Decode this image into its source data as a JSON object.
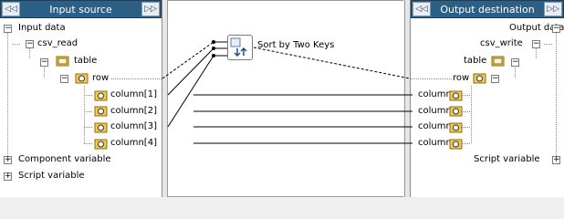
{
  "left_panel": {
    "title": "Input source",
    "prev_label": "◁◁",
    "next_label": "▷▷",
    "tree": {
      "root": "Input data",
      "csv": "csv_read",
      "table": "table",
      "row": "row",
      "columns": [
        "column[1]",
        "column[2]",
        "column[3]",
        "column[4]"
      ],
      "component_var": "Component variable",
      "script_var": "Script variable"
    }
  },
  "right_panel": {
    "title": "Output destination",
    "prev_label": "◁◁",
    "next_label": "▷▷",
    "tree": {
      "root": "Output data",
      "csv": "csv_write",
      "table": "table",
      "row": "row",
      "columns": [
        "column",
        "column",
        "column",
        "column"
      ],
      "script_var": "Script variable"
    }
  },
  "canvas": {
    "sort_node_label": "Sort by Two Keys"
  }
}
